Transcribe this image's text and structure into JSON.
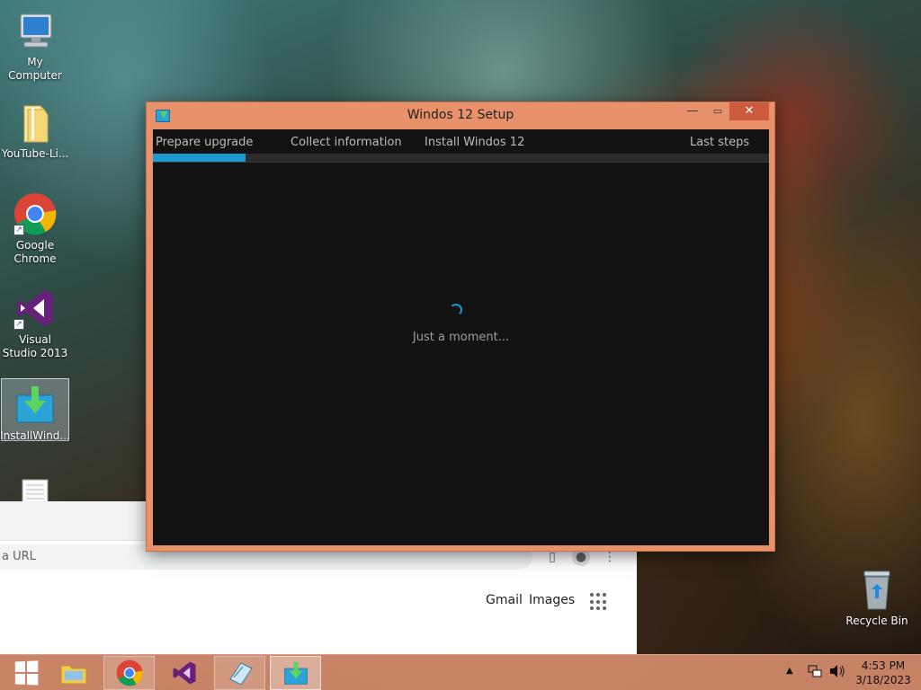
{
  "desktop": {
    "icons": [
      {
        "label": "My Computer"
      },
      {
        "label": "YouTube-Li..."
      },
      {
        "label": "Google Chrome"
      },
      {
        "label": "Visual Studio 2013"
      },
      {
        "label": "InstallWind..."
      },
      {
        "label": ""
      }
    ],
    "recycle_bin": {
      "label": "Recycle Bin"
    }
  },
  "browser": {
    "omnibox_placeholder": "a URL",
    "gmail_link": "Gmail",
    "images_link": "Images"
  },
  "setup": {
    "title": "Windos 12 Setup",
    "steps": [
      "Prepare upgrade",
      "Collect information",
      "Install Windos 12",
      "Last steps"
    ],
    "progress_percent": 15,
    "status": "Just a moment..."
  },
  "taskbar": {
    "buttons": [
      "start",
      "file-explorer",
      "google-chrome",
      "visual-studio",
      "notepad",
      "install-windows"
    ],
    "clock": {
      "time": "4:53 PM",
      "date": "3/18/2023"
    }
  },
  "colors": {
    "window_frame": "#e8916a",
    "close_button": "#cc5a3e",
    "progress": "#1b9ad0",
    "client_background": "#121212"
  }
}
